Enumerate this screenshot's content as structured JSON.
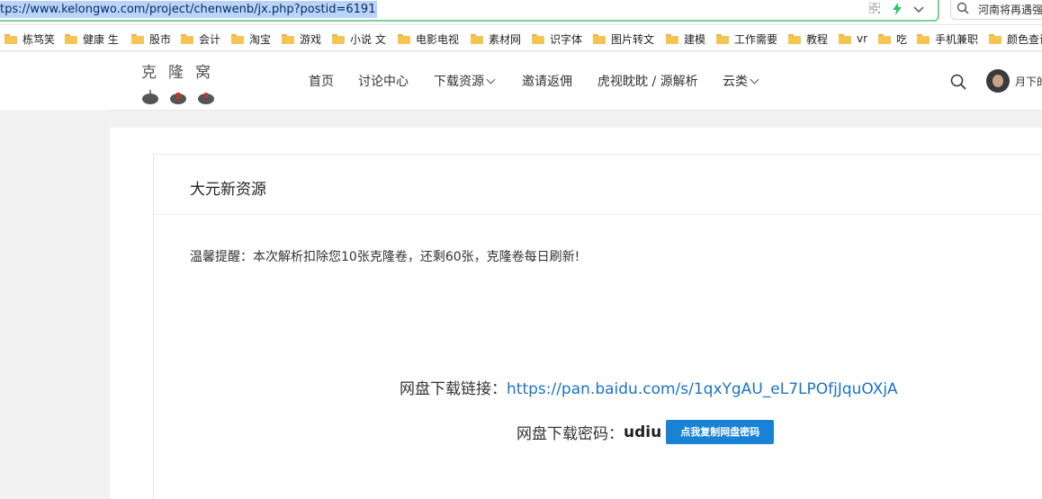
{
  "browser": {
    "url": "tps://www.kelongwo.com/project/chenwenb/jx.php?postid=6191",
    "search_text": "河南将再遇强"
  },
  "bookmarks": [
    {
      "label": "栋笃笑"
    },
    {
      "label": "健康 生"
    },
    {
      "label": "股市"
    },
    {
      "label": "会计"
    },
    {
      "label": "淘宝"
    },
    {
      "label": "游戏"
    },
    {
      "label": "小说 文"
    },
    {
      "label": "电影电视"
    },
    {
      "label": "素材网"
    },
    {
      "label": "识字体"
    },
    {
      "label": "图片转文"
    },
    {
      "label": "建模"
    },
    {
      "label": "工作需要"
    },
    {
      "label": "教程"
    },
    {
      "label": "vr"
    },
    {
      "label": "吃"
    },
    {
      "label": "手机兼职"
    },
    {
      "label": "颜色查询"
    }
  ],
  "site": {
    "logo_text": "克隆窝",
    "nav": [
      {
        "label": "首页",
        "has_dropdown": false
      },
      {
        "label": "讨论中心",
        "has_dropdown": false
      },
      {
        "label": "下载资源",
        "has_dropdown": true
      },
      {
        "label": "邀请返佣",
        "has_dropdown": false
      },
      {
        "label": "虎视眈眈 / 源解析",
        "has_dropdown": false
      },
      {
        "label": "云类",
        "has_dropdown": true
      }
    ],
    "user_name": "月下的"
  },
  "card": {
    "title": "大元新资源",
    "notice": "温馨提醒：本次解析扣除您10张克隆卷，还剩60张，克隆卷每日刷新!",
    "link_label": "网盘下载链接：",
    "link_url": "https://pan.baidu.com/s/1qxYgAU_eL7LPOfjJquOXjA",
    "pwd_label": "网盘下载密码：",
    "pwd_value": "udiu",
    "copy_button": "点我复制网盘密码"
  },
  "colors": {
    "accent_blue": "#1a82d4",
    "link_blue": "#1a73c8",
    "url_highlight": "#b9d4fb",
    "address_border": "#7ccf9a"
  }
}
